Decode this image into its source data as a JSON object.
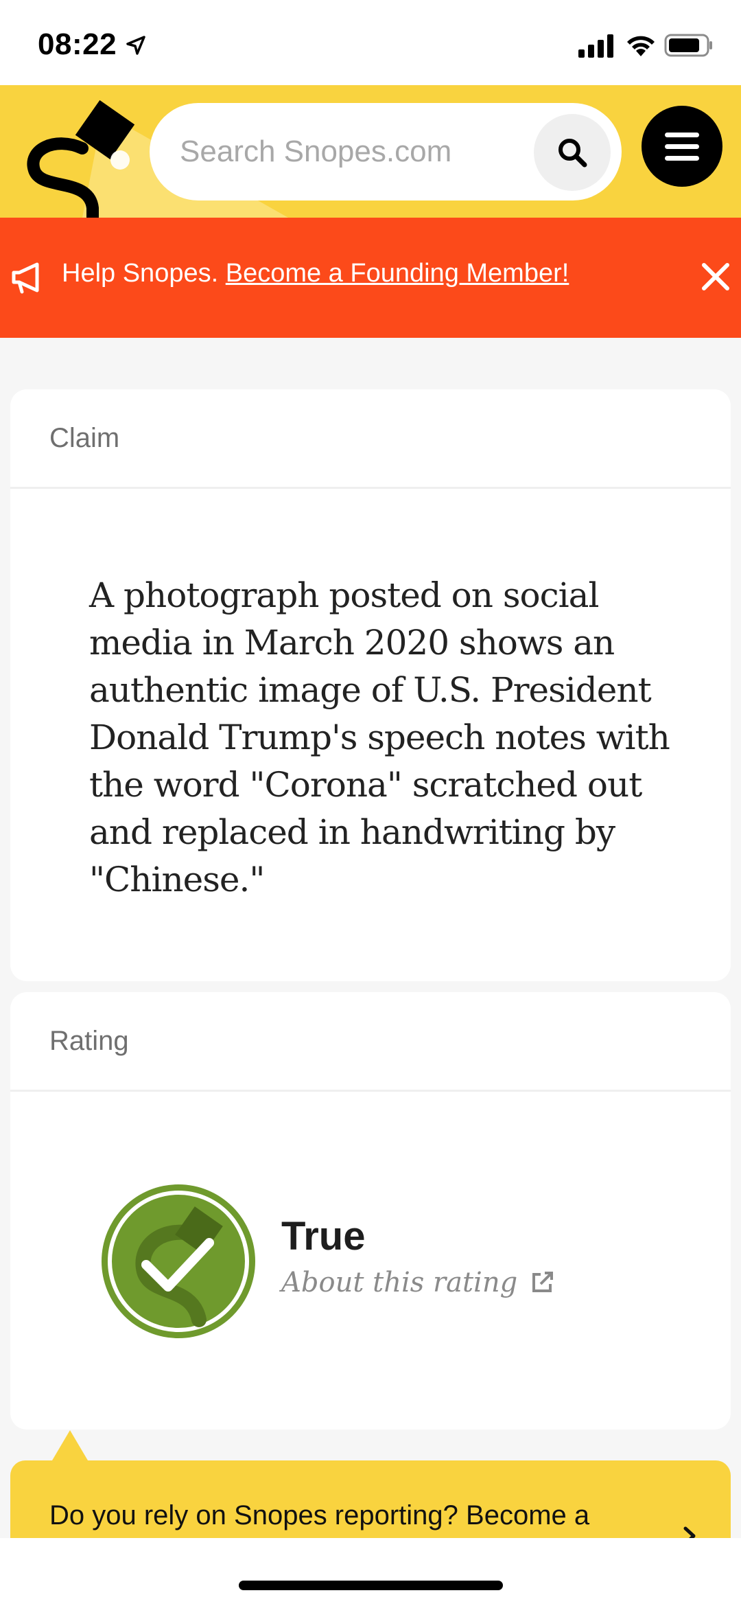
{
  "status_bar": {
    "time": "08:22"
  },
  "header": {
    "search": {
      "placeholder": "Search Snopes.com"
    },
    "brand_color": "#f9d33f"
  },
  "banner": {
    "text": "Help Snopes.",
    "link_text": "Become a Founding Member!",
    "background": "#fc4a1a"
  },
  "claim": {
    "label": "Claim",
    "text": "A photograph posted on social media in March 2020 shows an authentic image of U.S. President Donald Trump's speech notes with the word \"Corona\" scratched out and replaced in handwriting by \"Chinese.\""
  },
  "rating": {
    "label": "Rating",
    "value": "True",
    "about_link": "About this rating",
    "badge_color": "#6f9a2d"
  },
  "cta": {
    "text": "Do you rely on Snopes reporting? Become a"
  }
}
